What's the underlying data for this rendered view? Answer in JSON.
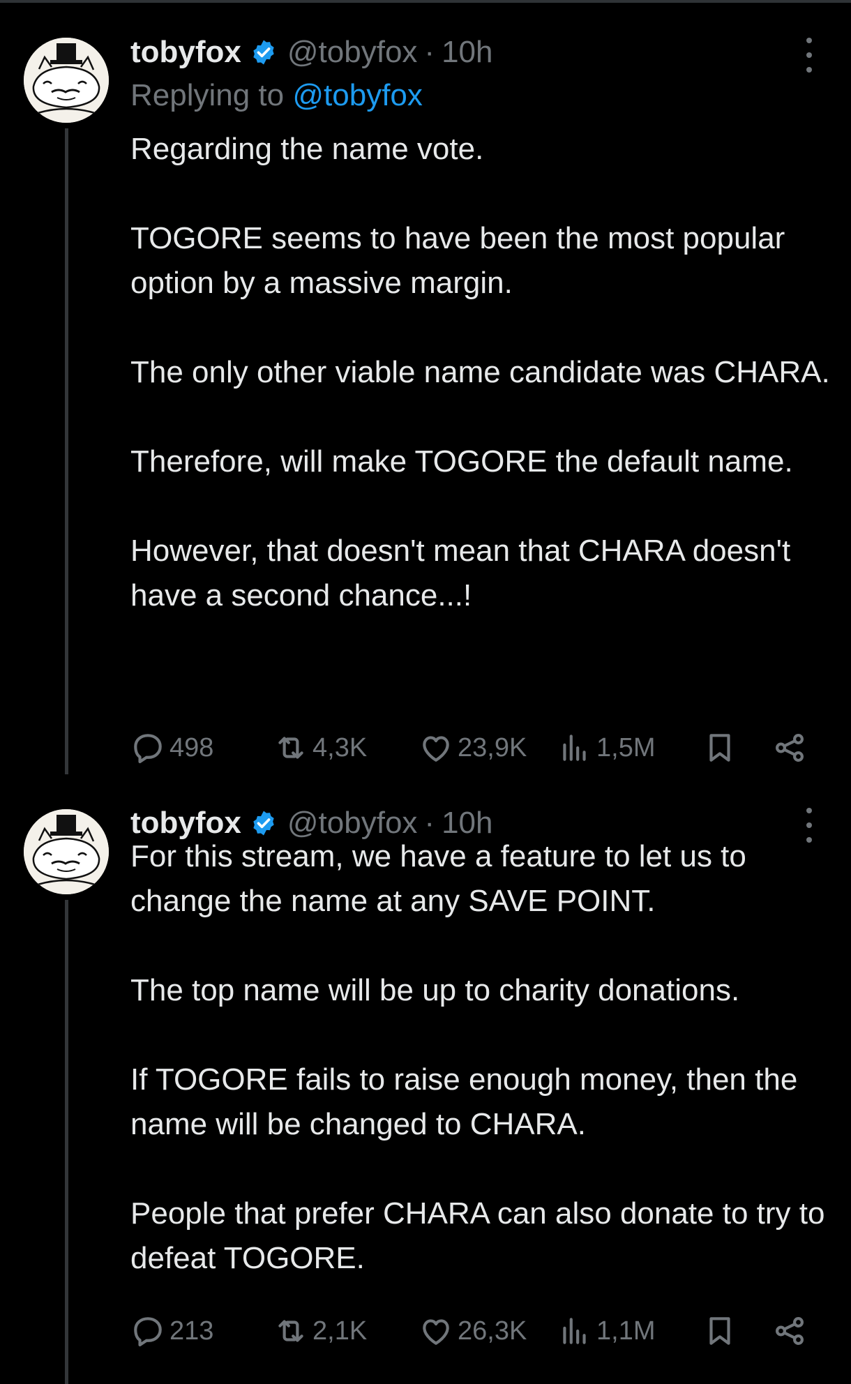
{
  "tweets": [
    {
      "display_name": "tobyfox",
      "handle": "@tobyfox",
      "separator": "·",
      "time": "10h",
      "replying_prefix": "Replying to",
      "replying_handle": "@tobyfox",
      "paragraphs": [
        "Regarding the name vote.",
        "TOGORE seems to have been the most popular option by a massive margin.",
        "The only other viable name candidate was CHARA.",
        "Therefore, will make TOGORE the default name.",
        "However, that doesn't mean that CHARA doesn't have a second chance...!"
      ],
      "replies": "498",
      "reposts": "4,3K",
      "likes": "23,9K",
      "views": "1,5M"
    },
    {
      "display_name": "tobyfox",
      "handle": "@tobyfox",
      "separator": "·",
      "time": "10h",
      "paragraphs": [
        "For this stream, we have a feature to let us to change the name at any SAVE POINT.",
        "The top name will be up to charity donations.",
        "If TOGORE fails to raise enough money, then the name will be changed to CHARA.",
        "People that prefer CHARA can also donate to try to defeat TOGORE."
      ],
      "replies": "213",
      "reposts": "2,1K",
      "likes": "26,3K",
      "views": "1,1M"
    }
  ],
  "colors": {
    "background": "#000000",
    "text": "#e7e9ea",
    "muted": "#71767b",
    "link": "#1d9bf0",
    "verified": "#1d9bf0"
  },
  "icons": [
    "avatar-dog-in-top-hat",
    "verified-badge-icon",
    "more-options-icon",
    "reply-icon",
    "repost-icon",
    "like-icon",
    "views-icon",
    "bookmark-icon",
    "share-icon"
  ]
}
